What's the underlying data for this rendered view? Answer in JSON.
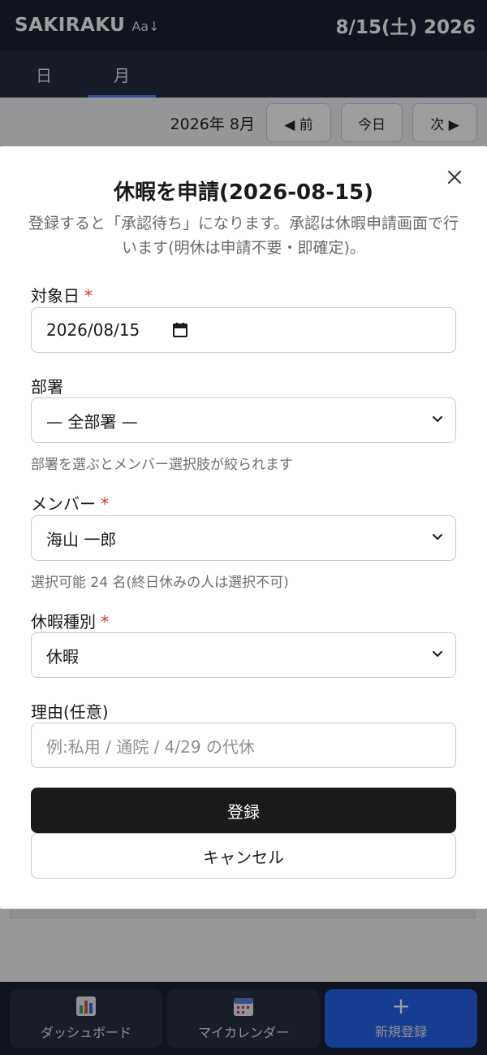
{
  "header": {
    "brand": "SAKIRAKU",
    "font_toggle": "Aa↓",
    "date": "8/15(土) 2026"
  },
  "tabs": [
    {
      "label": "日"
    },
    {
      "label": "月"
    }
  ],
  "month_bar": {
    "month": "2026年 8月",
    "prev": "◀ 前",
    "today": "今日",
    "next": "次 ▶"
  },
  "bottom_nav": {
    "dashboard": "ダッシュボード",
    "my_calendar": "マイカレンダー",
    "new_entry": "新規登録"
  },
  "modal": {
    "title": "休暇を申請(2026-08-15)",
    "description": "登録すると「承認待ち」になります。承認は休暇申請画面で行います(明休は申請不要・即確定)。",
    "target_date": {
      "label": "対象日",
      "required_mark": "*",
      "value": "2026/08/15"
    },
    "department": {
      "label": "部署",
      "value": "— 全部署 —",
      "hint": "部署を選ぶとメンバー選択肢が絞られます"
    },
    "member": {
      "label": "メンバー",
      "required_mark": "*",
      "value": "海山 一郎",
      "hint": "選択可能 24 名(終日休みの人は選択不可)"
    },
    "leave_type": {
      "label": "休暇種別",
      "required_mark": "*",
      "value": "休暇"
    },
    "reason": {
      "label": "理由(任意)",
      "placeholder": "例:私用 / 通院 / 4/29 の代休"
    },
    "submit": "登録",
    "cancel": "キャンセル"
  },
  "colors": {
    "header_bg": "#1b2131",
    "primary": "#2563eb",
    "required": "#d93025",
    "submit_bg": "#1a1a1a"
  }
}
